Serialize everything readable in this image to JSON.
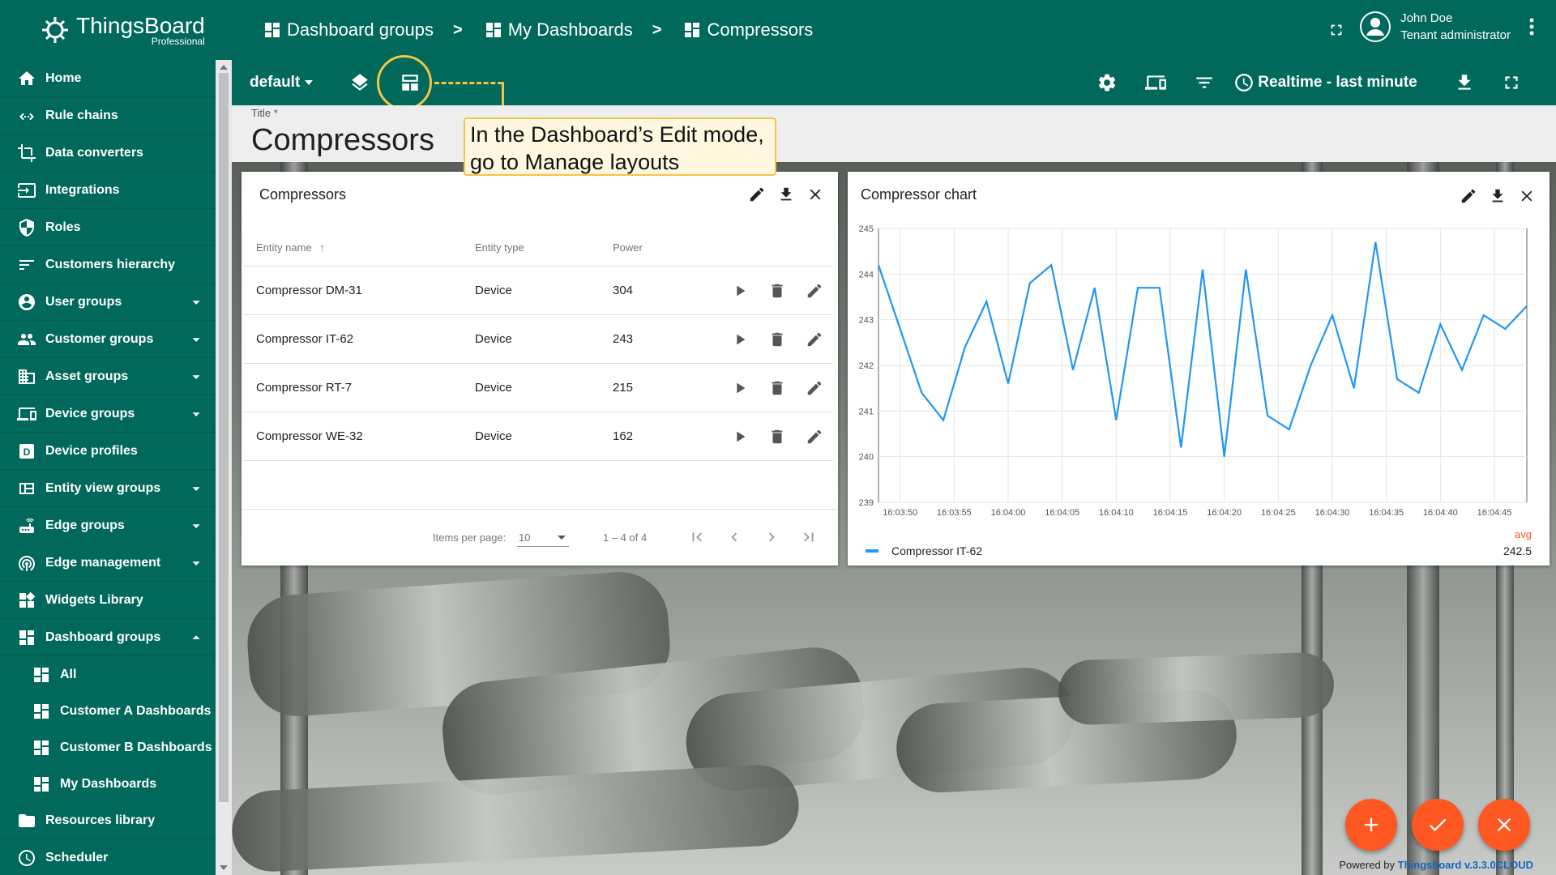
{
  "app": {
    "logo_title": "ThingsBoard",
    "logo_sub": "Professional"
  },
  "sidebar": {
    "items": [
      {
        "label": "Home",
        "icon": "home-icon"
      },
      {
        "label": "Rule chains",
        "icon": "rule-chains-icon"
      },
      {
        "label": "Data converters",
        "icon": "crop-icon"
      },
      {
        "label": "Integrations",
        "icon": "input-icon"
      },
      {
        "label": "Roles",
        "icon": "shield-icon"
      },
      {
        "label": "Customers hierarchy",
        "icon": "sort-icon"
      },
      {
        "label": "User groups",
        "icon": "account-circle-icon",
        "expandable": true
      },
      {
        "label": "Customer groups",
        "icon": "people-icon",
        "expandable": true
      },
      {
        "label": "Asset groups",
        "icon": "domain-icon",
        "expandable": true
      },
      {
        "label": "Device groups",
        "icon": "devices-icon",
        "expandable": true
      },
      {
        "label": "Device profiles",
        "icon": "device-profile-icon"
      },
      {
        "label": "Entity view groups",
        "icon": "view-quilt-icon",
        "expandable": true
      },
      {
        "label": "Edge groups",
        "icon": "router-icon",
        "expandable": true
      },
      {
        "label": "Edge management",
        "icon": "wifi-tethering-icon",
        "expandable": true
      },
      {
        "label": "Widgets Library",
        "icon": "widgets-icon"
      },
      {
        "label": "Dashboard groups",
        "icon": "dashboard-icon",
        "expanded": true
      }
    ],
    "sub_items": [
      {
        "label": "All"
      },
      {
        "label": "Customer A Dashboards"
      },
      {
        "label": "Customer B Dashboards"
      },
      {
        "label": "My Dashboards"
      }
    ],
    "bottom_items": [
      {
        "label": "Resources library",
        "icon": "folder-icon"
      },
      {
        "label": "Scheduler",
        "icon": "schedule-icon"
      }
    ]
  },
  "breadcrumb": [
    "Dashboard groups",
    "My Dashboards",
    "Compressors"
  ],
  "breadcrumb_sep": ">",
  "user": {
    "name": "John Doe",
    "role": "Tenant administrator"
  },
  "toolbar": {
    "layout": "default",
    "realtime": "Realtime - last minute"
  },
  "title_area": {
    "label": "Title *",
    "title": "Compressors"
  },
  "callout": {
    "line1": "In the Dashboard’s Edit mode,",
    "line2": "go to Manage layouts"
  },
  "table_widget": {
    "title": "Compressors",
    "columns": [
      "Entity name",
      "Entity type",
      "Power"
    ],
    "rows": [
      {
        "name": "Compressor DM-31",
        "type": "Device",
        "power": "304"
      },
      {
        "name": "Compressor IT-62",
        "type": "Device",
        "power": "243"
      },
      {
        "name": "Compressor RT-7",
        "type": "Device",
        "power": "215"
      },
      {
        "name": "Compressor WE-32",
        "type": "Device",
        "power": "162"
      }
    ],
    "items_per_page_label": "Items per page:",
    "items_per_page": "10",
    "range": "1 – 4 of 4"
  },
  "chart_widget": {
    "title": "Compressor chart",
    "legend": "Compressor IT-62",
    "avg_label": "avg",
    "avg_value": "242.5"
  },
  "chart_data": {
    "type": "line",
    "x": [
      "16:03:50",
      "16:03:55",
      "16:04:00",
      "16:04:05",
      "16:04:10",
      "16:04:15",
      "16:04:20",
      "16:04:25",
      "16:04:30",
      "16:04:35",
      "16:04:40",
      "16:04:45"
    ],
    "yticks": [
      239,
      240,
      241,
      242,
      243,
      244,
      245
    ],
    "ylim": [
      239,
      245
    ],
    "xlim_seconds": [
      0,
      60
    ],
    "series": [
      {
        "name": "Compressor IT-62",
        "color": "#2196f3",
        "points": [
          [
            0,
            244.2
          ],
          [
            2,
            242.8
          ],
          [
            4,
            241.4
          ],
          [
            6,
            240.8
          ],
          [
            8,
            242.4
          ],
          [
            10,
            243.4
          ],
          [
            12,
            241.6
          ],
          [
            14,
            243.8
          ],
          [
            16,
            244.2
          ],
          [
            18,
            241.9
          ],
          [
            20,
            243.7
          ],
          [
            22,
            240.8
          ],
          [
            24,
            243.7
          ],
          [
            26,
            243.7
          ],
          [
            28,
            240.2
          ],
          [
            30,
            244.1
          ],
          [
            32,
            240.0
          ],
          [
            34,
            244.1
          ],
          [
            36,
            240.9
          ],
          [
            38,
            240.6
          ],
          [
            40,
            242.0
          ],
          [
            42,
            243.1
          ],
          [
            44,
            241.5
          ],
          [
            46,
            244.7
          ],
          [
            48,
            241.7
          ],
          [
            50,
            241.4
          ],
          [
            52,
            242.9
          ],
          [
            54,
            241.9
          ],
          [
            56,
            243.1
          ],
          [
            58,
            242.8
          ],
          [
            60,
            243.3
          ]
        ]
      }
    ],
    "grid": true
  },
  "footer": {
    "powered_prefix": "Powered by ",
    "powered_link": "Thingsboard v.3.3.0CLOUD"
  },
  "colors": {
    "primary": "#00695c",
    "accent": "#ff5722",
    "highlight": "#f6c343",
    "series": "#2196f3"
  }
}
